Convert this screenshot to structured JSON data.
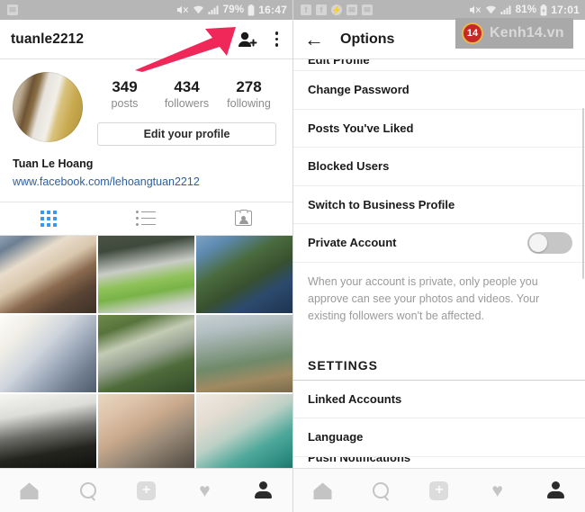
{
  "left_panel": {
    "statusbar": {
      "left_icons": [
        "envelope-icon"
      ],
      "mute_icon": "mute-icon",
      "wifi_icon": "wifi-icon",
      "signal_icon": "signal-icon",
      "battery_pct": "79%",
      "battery_icon": "battery-icon",
      "time": "16:47"
    },
    "header": {
      "username": "tuanle2212",
      "add_person_icon": "add-person-icon",
      "menu_icon": "kebab-menu-icon"
    },
    "profile": {
      "avatar_alt": "profile-avatar",
      "stats": [
        {
          "num": "349",
          "label": "posts"
        },
        {
          "num": "434",
          "label": "followers"
        },
        {
          "num": "278",
          "label": "following"
        }
      ],
      "edit_button": "Edit your profile",
      "name": "Tuan Le Hoang",
      "link": "www.facebook.com/lehoangtuan2212"
    },
    "tabs": [
      {
        "name": "grid-tab",
        "icon": "grid-icon",
        "active": true
      },
      {
        "name": "list-tab",
        "icon": "list-icon",
        "active": false
      },
      {
        "name": "tagged-tab",
        "icon": "tagged-person-icon",
        "active": false
      }
    ],
    "photos": [
      {
        "name": "photo-woman-eating",
        "g": "linear-gradient(150deg,#8fa3b8 0%,#6d7f92 12%,#e8dccb 30%,#d9c7ad 46%,#8a6a4e 62%,#5a4434 78%,#3d3028 100%)"
      },
      {
        "name": "photo-green-drink",
        "g": "linear-gradient(170deg,#4a5245 0%,#3e4a3c 18%,#c9ccc6 42%,#8fc25a 58%,#79b347 70%,#cfd2cc 88%,#e3e5e0 100%)"
      },
      {
        "name": "photo-man-viewpoint",
        "g": "linear-gradient(150deg,#7ea3c4 0%,#5d8ab0 16%,#4a6b3e 38%,#38502f 58%,#2c4a6e 74%,#1f3350 100%)"
      },
      {
        "name": "photo-sun-flare",
        "g": "linear-gradient(135deg,#fdfdfb 0%,#f0eee6 22%,#cfd4dd 44%,#9aa6b6 64%,#6e7c8e 82%,#4f5c6c 100%)"
      },
      {
        "name": "photo-couple-road",
        "g": "linear-gradient(160deg,#6f8a4a 0%,#58743c 18%,#c3cbb4 36%,#9aa494 52%,#4e6b3a 70%,#32492a 100%)"
      },
      {
        "name": "photo-misty-forest",
        "g": "linear-gradient(170deg,#c9d2d4 0%,#b3bfc2 20%,#8ea192 42%,#6f8a6a 60%,#a08a62 80%,#7b6a4a 100%)"
      },
      {
        "name": "photo-silhouette",
        "g": "linear-gradient(170deg,#f6f6f4 0%,#dcdcd8 26%,#6a6a66 50%,#24241f 72%,#0d0d0b 100%)"
      },
      {
        "name": "photo-glasses-selfie",
        "g": "linear-gradient(150deg,#e9d6c2 0%,#dcc2a8 22%,#c9a98c 42%,#9a8a78 62%,#6e6458 82%,#4a453d 100%)"
      },
      {
        "name": "photo-teal-blur",
        "g": "linear-gradient(150deg,#efeae2 0%,#e2dbd0 26%,#bcd0c6 46%,#4fa89a 68%,#2e8e82 86%,#1f6f66 100%)"
      }
    ],
    "arrow": {
      "name": "annotation-arrow-menu",
      "color": "#f0285a"
    }
  },
  "right_panel": {
    "statusbar": {
      "left_icons": [
        "facebook-icon",
        "facebook-icon",
        "messenger-icon",
        "envelope-icon",
        "envelope-icon"
      ],
      "mute_icon": "mute-icon",
      "wifi_icon": "wifi-icon",
      "signal_icon": "signal-icon",
      "battery_pct": "81%",
      "battery_icon": "battery-charging-icon",
      "time": "17:01"
    },
    "header": {
      "back_icon": "back-arrow-icon",
      "title": "Options"
    },
    "watermark": {
      "badge": "14",
      "text": "Kenh14.vn"
    },
    "menu_items": [
      {
        "label": "Edit Profile",
        "clipped": true
      },
      {
        "label": "Change Password",
        "clipped": false
      },
      {
        "label": "Posts You've Liked",
        "clipped": false
      },
      {
        "label": "Blocked Users",
        "clipped": false
      },
      {
        "label": "Switch to Business Profile",
        "clipped": false
      }
    ],
    "private_account": {
      "label": "Private Account",
      "toggle_state": "off",
      "description": "When your account is private, only people you approve can see your photos and videos. Your existing followers won't be affected."
    },
    "settings_section": {
      "header": "SETTINGS",
      "items": [
        {
          "label": "Linked Accounts",
          "clipped": false
        },
        {
          "label": "Language",
          "clipped": false
        },
        {
          "label": "Push Notifications",
          "clipped": true
        }
      ]
    },
    "arrow": {
      "name": "annotation-arrow-toggle",
      "color": "#f0285a"
    }
  },
  "bottom_nav": [
    {
      "name": "nav-home",
      "icon": "home-icon",
      "active": false
    },
    {
      "name": "nav-search",
      "icon": "search-icon",
      "active": false
    },
    {
      "name": "nav-add",
      "icon": "plus-square-icon",
      "active": false
    },
    {
      "name": "nav-activity",
      "icon": "heart-icon",
      "active": false
    },
    {
      "name": "nav-profile",
      "icon": "person-icon",
      "active": true
    }
  ],
  "colors": {
    "accent_blue": "#3897f0",
    "arrow_pink": "#f0285a",
    "link_blue": "#2f5e9e",
    "statusbar_gray": "#b6b6b6"
  }
}
